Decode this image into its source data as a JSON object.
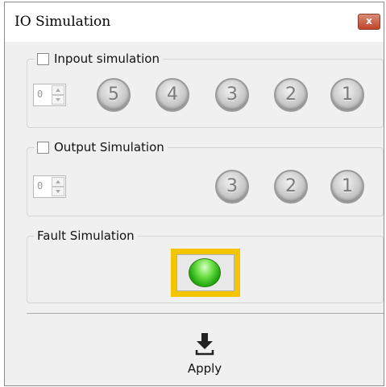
{
  "window": {
    "title": "IO Simulation",
    "close_glyph": "x"
  },
  "input_sim": {
    "label": "Inpout simulation",
    "checked": false,
    "spinner_value": "0",
    "leds": [
      "5",
      "4",
      "3",
      "2",
      "1"
    ]
  },
  "output_sim": {
    "label": "Output Simulation",
    "checked": false,
    "spinner_value": "0",
    "leds": [
      "3",
      "2",
      "1"
    ]
  },
  "fault_sim": {
    "label": "Fault Simulation",
    "indicator_color": "#22a80e",
    "highlight_color": "#f5c400"
  },
  "footer": {
    "apply_label": "Apply",
    "apply_icon": "download-icon"
  }
}
